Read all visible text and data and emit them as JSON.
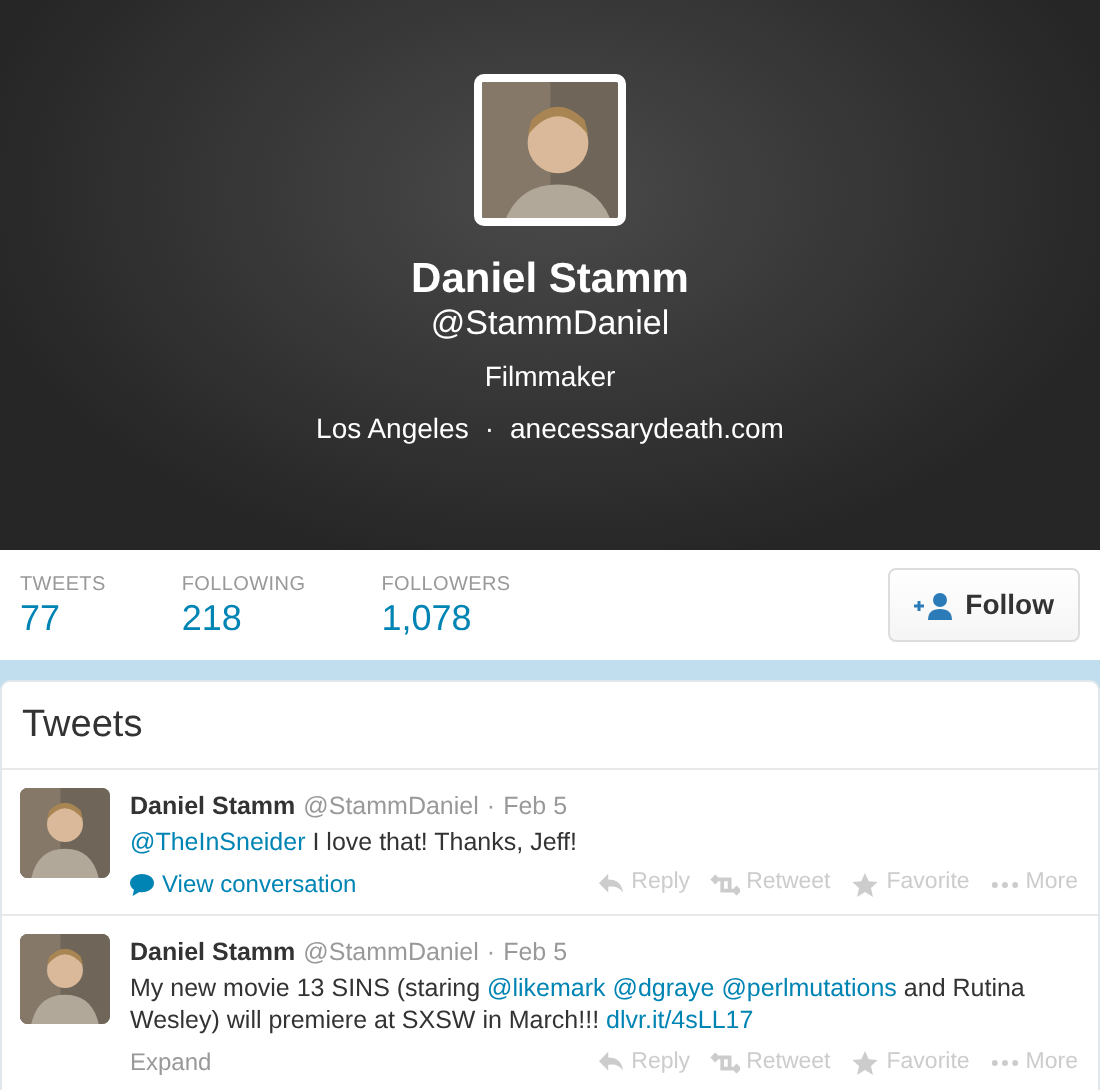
{
  "profile": {
    "name": "Daniel Stamm",
    "handle": "@StammDaniel",
    "bio": "Filmmaker",
    "location": "Los Angeles",
    "separator": "·",
    "website": "anecessarydeath.com"
  },
  "stats": [
    {
      "label": "TWEETS",
      "value": "77"
    },
    {
      "label": "FOLLOWING",
      "value": "218"
    },
    {
      "label": "FOLLOWERS",
      "value": "1,078"
    }
  ],
  "follow_button": "Follow",
  "timeline": {
    "title": "Tweets",
    "tweets": [
      {
        "name": "Daniel Stamm",
        "handle": "@StammDaniel",
        "separator": "·",
        "date": "Feb 5",
        "segments": [
          {
            "text": "@TheInSneider",
            "link": true
          },
          {
            "text": " I love that! Thanks, Jeff!",
            "link": false
          }
        ],
        "footer": {
          "kind": "conversation",
          "label": "View conversation"
        },
        "actions": [
          "Reply",
          "Retweet",
          "Favorite",
          "More"
        ]
      },
      {
        "name": "Daniel Stamm",
        "handle": "@StammDaniel",
        "separator": "·",
        "date": "Feb 5",
        "segments": [
          {
            "text": "My new movie 13 SINS (staring ",
            "link": false
          },
          {
            "text": "@likemark",
            "link": true
          },
          {
            "text": "@dgraye",
            "link": true
          },
          {
            "text": "@perlmutations",
            "link": true
          },
          {
            "text": " and Rutina Wesley) will premiere at SXSW in March!!! ",
            "link": false
          },
          {
            "text": "dlvr.it/4sLL17",
            "link": true
          }
        ],
        "footer": {
          "kind": "expand",
          "label": "Expand"
        },
        "actions": [
          "Reply",
          "Retweet",
          "Favorite",
          "More"
        ]
      }
    ]
  }
}
